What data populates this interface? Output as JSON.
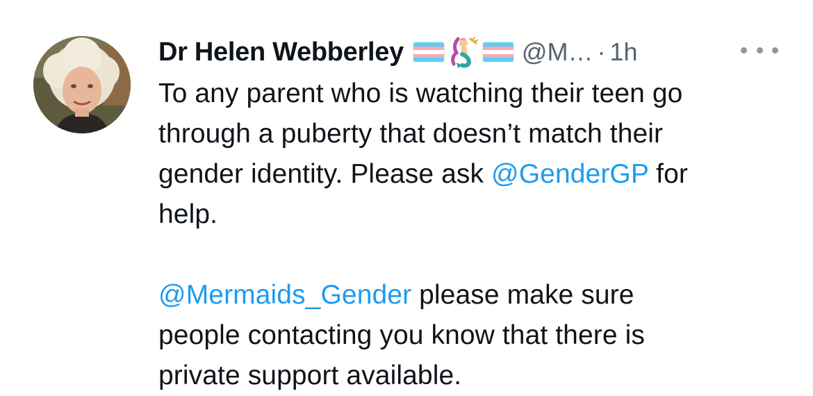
{
  "tweet": {
    "author": {
      "display_name": "Dr Helen Webberley",
      "name_emojis": [
        "transgender-flag-icon",
        "mermaid-icon",
        "transgender-flag-icon"
      ],
      "handle": "@M…",
      "separator": "·",
      "timestamp": "1h"
    },
    "more_icon": "more-horizontal-icon",
    "body": {
      "paragraph1": {
        "line1": "To any parent who is watching their teen go",
        "line2": "through a puberty that doesn’t match their",
        "line3_before": "gender identity. Please ask ",
        "line3_mention": "@GenderGP",
        "line3_after": " for",
        "line4": "help."
      },
      "paragraph2": {
        "line1_mention": "@Mermaids_Gender",
        "line1_after": " please make sure",
        "line2": "people contacting you know that there is",
        "line3": "private support available."
      }
    },
    "colors": {
      "text": "#0f1419",
      "secondary": "#536471",
      "mention": "#1d9bf0",
      "flag_blue": "#5bcefa",
      "flag_pink": "#f5a9b8"
    }
  }
}
